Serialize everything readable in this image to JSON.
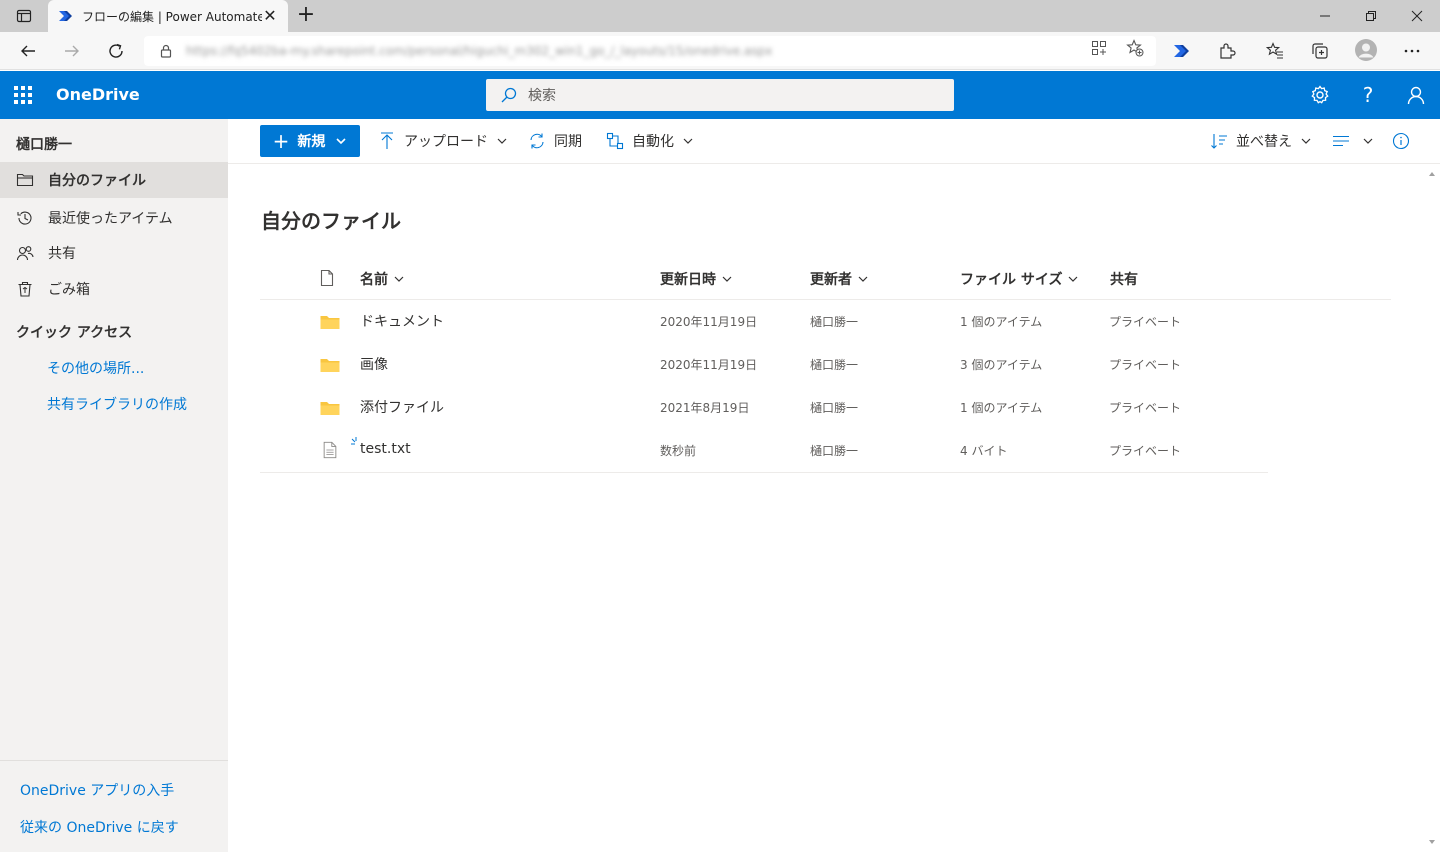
{
  "browser": {
    "tab_title": "フローの編集 | Power Automate",
    "url": "https://fq5402ba-my.sharepoint.com/personal/higuchi_m302_win1_go_/_layouts/15/onedrive.aspx"
  },
  "suite": {
    "brand": "OneDrive",
    "search_placeholder": "検索",
    "accent_color": "#0078d4"
  },
  "leftnav": {
    "user_name": "樋口勝一",
    "items": [
      {
        "label": "自分のファイル",
        "icon": "folder-icon"
      },
      {
        "label": "最近使ったアイテム",
        "icon": "history-icon"
      },
      {
        "label": "共有",
        "icon": "people-icon"
      },
      {
        "label": "ごみ箱",
        "icon": "recycle-bin-icon"
      }
    ],
    "quick_access_header": "クイック アクセス",
    "quick_access_links": [
      "その他の場所...",
      "共有ライブラリの作成"
    ],
    "bottom_links": [
      "OneDrive アプリの入手",
      "従来の OneDrive に戻す"
    ]
  },
  "commandbar": {
    "new_label": "新規",
    "upload_label": "アップロード",
    "sync_label": "同期",
    "automate_label": "自動化",
    "sort_label": "並べ替え"
  },
  "main": {
    "title": "自分のファイル",
    "columns": {
      "name": "名前",
      "modified": "更新日時",
      "modified_by": "更新者",
      "size": "ファイル サイズ",
      "sharing": "共有"
    },
    "rows": [
      {
        "type": "folder",
        "name": "ドキュメント",
        "modified": "2020年11月19日",
        "modified_by": "樋口勝一",
        "size": "1 個のアイテム",
        "sharing": "プライベート"
      },
      {
        "type": "folder",
        "name": "画像",
        "modified": "2020年11月19日",
        "modified_by": "樋口勝一",
        "size": "3 個のアイテム",
        "sharing": "プライベート"
      },
      {
        "type": "folder",
        "name": "添付ファイル",
        "modified": "2021年8月19日",
        "modified_by": "樋口勝一",
        "size": "1 個のアイテム",
        "sharing": "プライベート"
      },
      {
        "type": "file",
        "name": "test.txt",
        "modified": "数秒前",
        "modified_by": "樋口勝一",
        "size": "4 バイト",
        "sharing": "プライベート"
      }
    ]
  }
}
